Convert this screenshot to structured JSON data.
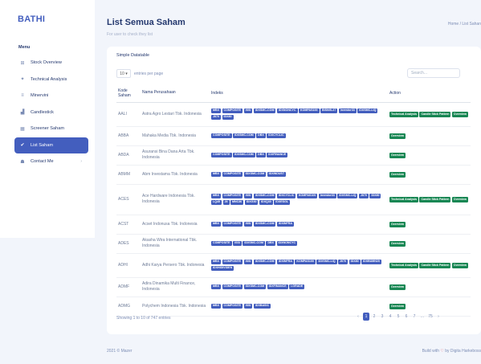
{
  "brand": "BATHI",
  "sidebar": {
    "menu_title": "Menu",
    "items": [
      {
        "label": "Stock Overview",
        "icon": "grid-icon",
        "glyph": "⊞"
      },
      {
        "label": "Technical Analysis",
        "icon": "chart-icon",
        "glyph": "✦"
      },
      {
        "label": "Minervini",
        "icon": "list-icon",
        "glyph": "≡"
      },
      {
        "label": "Candlestick",
        "icon": "bar-chart-icon",
        "glyph": "▟"
      },
      {
        "label": "Screener Saham",
        "icon": "filter-icon",
        "glyph": "▦"
      },
      {
        "label": "List Saham",
        "icon": "list-check-icon",
        "glyph": "✔"
      },
      {
        "label": "Contact Me",
        "icon": "people-icon",
        "glyph": "☗",
        "chevron": "›"
      }
    ],
    "active_index": 5
  },
  "header": {
    "title": "List Semua Saham",
    "subtitle": "For user to check they list",
    "breadcrumb": "Home / List Sahan"
  },
  "card": {
    "title": "Simple Datatable",
    "entries_value": "10 ▾",
    "entries_label": "entries per page",
    "search_placeholder": "Search..."
  },
  "table": {
    "headers": [
      "Kode Saham",
      "Nama Perusahaan",
      "Indeks",
      "Action"
    ],
    "rows": [
      {
        "kode": "AALI",
        "nama": "Astra Agro Lestari Tbk. Indonesia",
        "indeks": [
          "MBX",
          "COMPOSITE",
          "ISSI",
          "IDXSMC-COM",
          "IDXNONCYC",
          "KOMPAS100",
          "BISNIS-27",
          "Investor33",
          "IDXSMC-LIQ",
          "JII70",
          "IDX80"
        ],
        "actions": [
          "Technical Analysis",
          "Candle Stick Pattern",
          "Overview"
        ]
      },
      {
        "kode": "ABBA",
        "nama": "Mahaka Media Tbk. Indonesia",
        "indeks": [
          "COMPOSITE",
          "IDXSMC-COM",
          "DBX",
          "IDXCYCLIC"
        ],
        "actions": [
          "Overview"
        ]
      },
      {
        "kode": "ABDA",
        "nama": "Asuransi Bina Dana Arta Tbk. Indonesia",
        "indeks": [
          "COMPOSITE",
          "IDXSMC-COM",
          "DBX",
          "IDXFINANCE"
        ],
        "actions": [
          "Overview"
        ]
      },
      {
        "kode": "ABMM",
        "nama": "Abm Investama Tbk. Indonesia",
        "indeks": [
          "MBX",
          "COMPOSITE",
          "IDXSMC-COM",
          "IDXINDUST"
        ],
        "actions": [
          "Overview"
        ]
      },
      {
        "kode": "ACES",
        "nama": "Ace Hardware Indonesia Tbk. Indonesia",
        "indeks": [
          "MBX",
          "COMPOSITE",
          "ISSI",
          "IDXSMC-COM",
          "IDXCYCLIC",
          "KOMPAS100",
          "Investor33",
          "IDXSMC-LIQ",
          "JII70",
          "IDX80",
          "LQ45",
          "JII",
          "MNC36",
          "IDXG30",
          "IDXQ30",
          "IDXESGL"
        ],
        "actions": [
          "Technical Analysis",
          "Candle Stick Pattern",
          "Overview"
        ]
      },
      {
        "kode": "ACST",
        "nama": "Acset Indonusa Tbk. Indonesia",
        "indeks": [
          "MBX",
          "COMPOSITE",
          "ISSI",
          "IDXSMC-COM",
          "IDXINFRA"
        ],
        "actions": [
          "Overview"
        ]
      },
      {
        "kode": "ADES",
        "nama": "Akasha Wira International Tbk. Indonesia",
        "indeks": [
          "COMPOSITE",
          "ISSI",
          "IDXSMC-COM",
          "DBX",
          "IDXNONCYC"
        ],
        "actions": [
          "Overview"
        ]
      },
      {
        "kode": "ADHI",
        "nama": "Adhi Karya Persero Tbk. Indonesia",
        "indeks": [
          "MBX",
          "COMPOSITE",
          "ISSI",
          "IDXSMC-COM",
          "IDXINFRA",
          "KOMPAS100",
          "IDXSMC-LIQ",
          "JII70",
          "IDX80",
          "IDXBUMN20",
          "IDXHIDIVIDEN"
        ],
        "actions": [
          "Technical Analysis",
          "Candle Stick Pattern",
          "Overview"
        ]
      },
      {
        "kode": "ADMF",
        "nama": "Adira Dinamika Multi Finance, Indonesia",
        "indeks": [
          "MBX",
          "COMPOSITE",
          "IDXSMC-COM",
          "IDXFINANCE",
          "I-GRADE"
        ],
        "actions": [
          "Overview"
        ]
      },
      {
        "kode": "ADMG",
        "nama": "Polychem Indonesia Tbk. Indonesia",
        "indeks": [
          "MBX",
          "COMPOSITE",
          "ISSI",
          "IDXBASIC"
        ],
        "actions": [
          "Overview"
        ]
      }
    ]
  },
  "pagination": {
    "info": "Showing 1 to 10 of 747 entries",
    "pages": [
      "‹",
      "1",
      "2",
      "3",
      "4",
      "5",
      "6",
      "7",
      "...",
      "75",
      "›"
    ],
    "active": "1"
  },
  "footer": {
    "left": "2021 © Mazer",
    "right_prefix": "Build with",
    "heart": "♡",
    "right_suffix": "by Digita Harkeboss"
  }
}
